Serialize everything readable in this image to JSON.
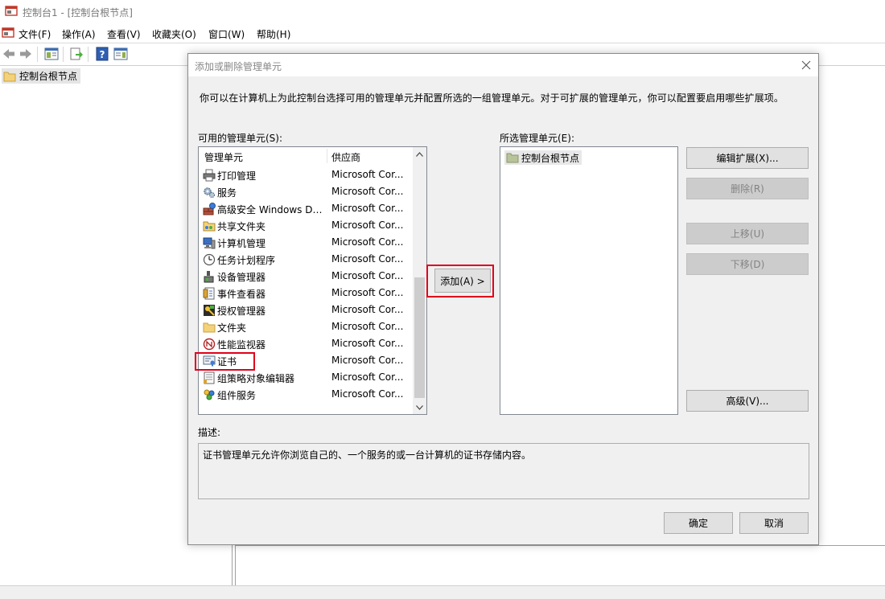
{
  "window": {
    "title": "控制台1 - [控制台根节点]"
  },
  "menubar": {
    "items": [
      "文件(F)",
      "操作(A)",
      "查看(V)",
      "收藏夹(O)",
      "窗口(W)",
      "帮助(H)"
    ]
  },
  "toolbar": {
    "buttons": [
      "back-arrow-icon",
      "forward-arrow-icon",
      "show-hide-tree-icon",
      "export-list-icon",
      "help-icon",
      "show-action-pane-icon"
    ]
  },
  "tree": {
    "root_label": "控制台根节点"
  },
  "dialog": {
    "title": "添加或删除管理单元",
    "intro": "你可以在计算机上为此控制台选择可用的管理单元并配置所选的一组管理单元。对于可扩展的管理单元，你可以配置要启用哪些扩展项。",
    "available_label": "可用的管理单元(S):",
    "selected_label": "所选管理单元(E):",
    "columns": {
      "name": "管理单元",
      "vendor": "供应商"
    },
    "snapins": [
      {
        "name": "打印管理",
        "vendor": "Microsoft Cor...",
        "icon": "printer-icon"
      },
      {
        "name": "服务",
        "vendor": "Microsoft Cor...",
        "icon": "gears-icon"
      },
      {
        "name": "高级安全 Windows De...",
        "vendor": "Microsoft Cor...",
        "icon": "firewall-icon"
      },
      {
        "name": "共享文件夹",
        "vendor": "Microsoft Cor...",
        "icon": "shared-folder-icon"
      },
      {
        "name": "计算机管理",
        "vendor": "Microsoft Cor...",
        "icon": "computer-management-icon"
      },
      {
        "name": "任务计划程序",
        "vendor": "Microsoft Cor...",
        "icon": "clock-icon"
      },
      {
        "name": "设备管理器",
        "vendor": "Microsoft Cor...",
        "icon": "device-manager-icon"
      },
      {
        "name": "事件查看器",
        "vendor": "Microsoft Cor...",
        "icon": "event-viewer-icon"
      },
      {
        "name": "授权管理器",
        "vendor": "Microsoft Cor...",
        "icon": "authorization-icon"
      },
      {
        "name": "文件夹",
        "vendor": "Microsoft Cor...",
        "icon": "folder-icon"
      },
      {
        "name": "性能监视器",
        "vendor": "Microsoft Cor...",
        "icon": "performance-monitor-icon"
      },
      {
        "name": "证书",
        "vendor": "Microsoft Cor...",
        "icon": "certificate-icon"
      },
      {
        "name": "组策略对象编辑器",
        "vendor": "Microsoft Cor...",
        "icon": "policy-editor-icon"
      },
      {
        "name": "组件服务",
        "vendor": "Microsoft Cor...",
        "icon": "component-services-icon"
      }
    ],
    "add_button": "添加(A) >",
    "selected_items": [
      "控制台根节点"
    ],
    "buttons": {
      "edit_extensions": "编辑扩展(X)...",
      "remove": "删除(R)",
      "move_up": "上移(U)",
      "move_down": "下移(D)",
      "advanced": "高级(V)...",
      "ok": "确定",
      "cancel": "取消"
    },
    "description_label": "描述:",
    "description": "证书管理单元允许你浏览自己的、一个服务的或一台计算机的证书存储内容。",
    "scroll_up": "^",
    "scroll_down": "v"
  },
  "colors": {
    "highlight": "#e0001b",
    "dialog_bg": "#f0f0f0",
    "button_bg": "#e1e1e1",
    "disabled_bg": "#cccccc"
  }
}
